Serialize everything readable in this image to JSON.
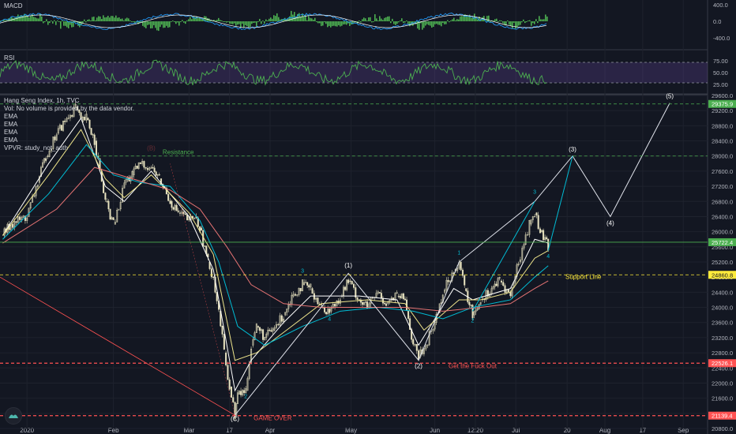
{
  "panes": {
    "macd": {
      "title": "MACD",
      "ticks": [
        "400.0",
        "0.0",
        "-400.0"
      ]
    },
    "rsi": {
      "title": "RSI",
      "ticks": [
        "75.00",
        "50.00",
        "25.00"
      ]
    }
  },
  "legend": {
    "symbol": "Hang Seng Index, 1h, TVC",
    "volume_note": "Vol: No volume is provided by the data vendor.",
    "ema_1": "EMA",
    "ema_2": "EMA",
    "ema_3": "EMA",
    "ema_4": "EMA",
    "vpvr": "VPVR: study_not_auth"
  },
  "colors": {
    "background": "#131722",
    "grid": "#1e222d",
    "candle": "#e8e3c0",
    "macd_line": "#2196f3",
    "signal_line": "#ffffff",
    "histogram": "#4caf50",
    "rsi_line": "#4caf50",
    "ema_fast": "#ffffff",
    "ema_mid": "#f0e68c",
    "ema_slow": "#00bcd4",
    "ema_long": "#e57373",
    "wave_projection": "#00bcd4",
    "support": "#ffeb3b",
    "danger": "#ff5252",
    "resistance": "#4caf50"
  },
  "chart_data": {
    "type": "candlestick",
    "title": "Hang Seng Index, 1h, TVC",
    "xlabel": "",
    "ylabel": "",
    "ylim": [
      20800,
      29600
    ],
    "y_ticks": [
      29600,
      29200,
      28800,
      28400,
      28000,
      27600,
      27200,
      26800,
      26400,
      26000,
      25600,
      25200,
      24800,
      24400,
      24000,
      23600,
      23200,
      22800,
      22400,
      22000,
      21600,
      21200,
      20800
    ],
    "x_range": [
      "2019-12-23",
      "2020-09-10"
    ],
    "x_ticks": [
      {
        "label": "2020",
        "date": "2020-01-02"
      },
      {
        "label": "Feb",
        "date": "2020-02-03"
      },
      {
        "label": "Mar",
        "date": "2020-03-02"
      },
      {
        "label": "17",
        "date": "2020-03-17"
      },
      {
        "label": "Apr",
        "date": "2020-04-01"
      },
      {
        "label": "May",
        "date": "2020-05-01"
      },
      {
        "label": "Jun",
        "date": "2020-06-01"
      },
      {
        "label": "12:20",
        "date": "2020-06-16"
      },
      {
        "label": "Jul",
        "date": "2020-07-01"
      },
      {
        "label": "20",
        "date": "2020-07-20"
      },
      {
        "label": "Aug",
        "date": "2020-08-03"
      },
      {
        "label": "17",
        "date": "2020-08-17"
      },
      {
        "label": "Sep",
        "date": "2020-09-01"
      }
    ],
    "price_path": [
      [
        "2019-12-24",
        25900
      ],
      [
        "2019-12-27",
        26200
      ],
      [
        "2020-01-02",
        26400
      ],
      [
        "2020-01-06",
        27300
      ],
      [
        "2020-01-09",
        28000
      ],
      [
        "2020-01-13",
        28600
      ],
      [
        "2020-01-16",
        28900
      ],
      [
        "2020-01-20",
        29300
      ],
      [
        "2020-01-22",
        28900
      ],
      [
        "2020-01-24",
        29000
      ],
      [
        "2020-01-27",
        28400
      ],
      [
        "2020-01-29",
        27600
      ],
      [
        "2020-01-31",
        26800
      ],
      [
        "2020-02-03",
        26200
      ],
      [
        "2020-02-05",
        26600
      ],
      [
        "2020-02-07",
        27300
      ],
      [
        "2020-02-10",
        27500
      ],
      [
        "2020-02-13",
        27800
      ],
      [
        "2020-02-17",
        27700
      ],
      [
        "2020-02-20",
        27400
      ],
      [
        "2020-02-24",
        26800
      ],
      [
        "2020-02-27",
        26500
      ],
      [
        "2020-03-02",
        26300
      ],
      [
        "2020-03-04",
        26400
      ],
      [
        "2020-03-06",
        26100
      ],
      [
        "2020-03-09",
        25200
      ],
      [
        "2020-03-11",
        24800
      ],
      [
        "2020-03-13",
        23900
      ],
      [
        "2020-03-15",
        22800
      ],
      [
        "2020-03-17",
        21900
      ],
      [
        "2020-03-19",
        21150
      ],
      [
        "2020-03-20",
        21700
      ],
      [
        "2020-03-23",
        21800
      ],
      [
        "2020-03-25",
        23000
      ],
      [
        "2020-03-27",
        23500
      ],
      [
        "2020-03-30",
        23200
      ],
      [
        "2020-04-02",
        23400
      ],
      [
        "2020-04-06",
        23800
      ],
      [
        "2020-04-09",
        24300
      ],
      [
        "2020-04-13",
        24600
      ],
      [
        "2020-04-16",
        24500
      ],
      [
        "2020-04-20",
        24000
      ],
      [
        "2020-04-23",
        23900
      ],
      [
        "2020-04-27",
        24300
      ],
      [
        "2020-04-30",
        24700
      ],
      [
        "2020-05-04",
        24200
      ],
      [
        "2020-05-07",
        24000
      ],
      [
        "2020-05-11",
        24400
      ],
      [
        "2020-05-14",
        24100
      ],
      [
        "2020-05-18",
        24300
      ],
      [
        "2020-05-21",
        24200
      ],
      [
        "2020-05-24",
        23000
      ],
      [
        "2020-05-26",
        22700
      ],
      [
        "2020-05-28",
        22900
      ],
      [
        "2020-06-01",
        23600
      ],
      [
        "2020-06-04",
        24400
      ],
      [
        "2020-06-08",
        25000
      ],
      [
        "2020-06-10",
        25200
      ],
      [
        "2020-06-12",
        24500
      ],
      [
        "2020-06-15",
        23800
      ],
      [
        "2020-06-18",
        24200
      ],
      [
        "2020-06-22",
        24500
      ],
      [
        "2020-06-25",
        24700
      ],
      [
        "2020-06-29",
        24300
      ],
      [
        "2020-07-02",
        25200
      ],
      [
        "2020-07-06",
        26200
      ],
      [
        "2020-07-08",
        26500
      ],
      [
        "2020-07-10",
        26000
      ],
      [
        "2020-07-13",
        25600
      ]
    ],
    "ema_lines": [
      {
        "color": "ema_fast",
        "points": [
          [
            "2019-12-24",
            25900
          ],
          [
            "2020-01-10",
            27800
          ],
          [
            "2020-01-22",
            29000
          ],
          [
            "2020-01-31",
            27200
          ],
          [
            "2020-02-07",
            26800
          ],
          [
            "2020-02-17",
            27600
          ],
          [
            "2020-03-02",
            26400
          ],
          [
            "2020-03-11",
            25000
          ],
          [
            "2020-03-19",
            21800
          ],
          [
            "2020-03-25",
            22600
          ],
          [
            "2020-04-06",
            23600
          ],
          [
            "2020-04-16",
            24300
          ],
          [
            "2020-05-04",
            24300
          ],
          [
            "2020-05-18",
            24200
          ],
          [
            "2020-05-26",
            23000
          ],
          [
            "2020-06-08",
            24500
          ],
          [
            "2020-06-15",
            24200
          ],
          [
            "2020-06-29",
            24500
          ],
          [
            "2020-07-08",
            25800
          ],
          [
            "2020-07-13",
            25700
          ]
        ]
      },
      {
        "color": "ema_mid",
        "points": [
          [
            "2019-12-24",
            25900
          ],
          [
            "2020-01-10",
            27500
          ],
          [
            "2020-01-22",
            28700
          ],
          [
            "2020-01-31",
            27400
          ],
          [
            "2020-02-07",
            26900
          ],
          [
            "2020-02-17",
            27500
          ],
          [
            "2020-03-02",
            26500
          ],
          [
            "2020-03-11",
            25400
          ],
          [
            "2020-03-19",
            22600
          ],
          [
            "2020-03-27",
            22800
          ],
          [
            "2020-04-09",
            23500
          ],
          [
            "2020-04-20",
            24100
          ],
          [
            "2020-05-07",
            24200
          ],
          [
            "2020-05-21",
            24100
          ],
          [
            "2020-05-28",
            23400
          ],
          [
            "2020-06-10",
            24200
          ],
          [
            "2020-06-18",
            24200
          ],
          [
            "2020-06-29",
            24400
          ],
          [
            "2020-07-08",
            25300
          ],
          [
            "2020-07-13",
            25500
          ]
        ]
      },
      {
        "color": "ema_slow",
        "points": [
          [
            "2019-12-24",
            25800
          ],
          [
            "2020-01-10",
            27000
          ],
          [
            "2020-01-24",
            28300
          ],
          [
            "2020-02-03",
            27500
          ],
          [
            "2020-02-13",
            27300
          ],
          [
            "2020-02-24",
            27200
          ],
          [
            "2020-03-06",
            26300
          ],
          [
            "2020-03-13",
            25200
          ],
          [
            "2020-03-20",
            23500
          ],
          [
            "2020-03-30",
            23000
          ],
          [
            "2020-04-13",
            23500
          ],
          [
            "2020-04-27",
            23900
          ],
          [
            "2020-05-11",
            24000
          ],
          [
            "2020-05-24",
            23900
          ],
          [
            "2020-06-04",
            23700
          ],
          [
            "2020-06-15",
            24000
          ],
          [
            "2020-06-29",
            24200
          ],
          [
            "2020-07-08",
            24800
          ],
          [
            "2020-07-13",
            25100
          ]
        ]
      },
      {
        "color": "ema_long",
        "points": [
          [
            "2019-12-24",
            25700
          ],
          [
            "2020-01-13",
            26600
          ],
          [
            "2020-01-27",
            27700
          ],
          [
            "2020-02-10",
            27400
          ],
          [
            "2020-02-24",
            27100
          ],
          [
            "2020-03-06",
            26600
          ],
          [
            "2020-03-16",
            25600
          ],
          [
            "2020-03-25",
            24600
          ],
          [
            "2020-04-06",
            24100
          ],
          [
            "2020-04-20",
            24000
          ],
          [
            "2020-05-07",
            24000
          ],
          [
            "2020-05-21",
            24000
          ],
          [
            "2020-06-04",
            23900
          ],
          [
            "2020-06-18",
            24000
          ],
          [
            "2020-06-29",
            24100
          ],
          [
            "2020-07-08",
            24500
          ],
          [
            "2020-07-13",
            24700
          ]
        ]
      }
    ],
    "wave_path": [
      [
        "2020-03-19",
        21150
      ],
      [
        "2020-04-30",
        24900
      ],
      [
        "2020-05-26",
        22600
      ],
      [
        "2020-06-10",
        25200
      ],
      [
        "2020-07-08",
        26800
      ],
      [
        "2020-07-22",
        28000
      ],
      [
        "2020-08-05",
        26400
      ],
      [
        "2020-08-27",
        29400
      ]
    ],
    "projection_path": [
      [
        "2020-06-15",
        23900
      ],
      [
        "2020-07-08",
        26800
      ]
    ],
    "projection_path_2": [
      [
        "2020-07-13",
        25500
      ],
      [
        "2020-07-22",
        28000
      ]
    ],
    "trendline": [
      [
        "2019-12-23",
        24800
      ],
      [
        "2020-03-19",
        21150
      ]
    ],
    "zigzag_red": [
      [
        "2020-03-19",
        21150
      ],
      [
        "2020-02-24",
        27800
      ]
    ],
    "horizontal_levels": [
      {
        "price": 29375.9,
        "label": "29375.9",
        "color": "resistance",
        "style": "dashed"
      },
      {
        "price": 28000,
        "label": "",
        "color": "resistance",
        "style": "dashed",
        "text": "Resistance"
      },
      {
        "price": 25722.4,
        "label": "25722.4",
        "color": "resistance",
        "style": "solid"
      },
      {
        "price": 24860.8,
        "label": "24860.8",
        "color": "support",
        "style": "dashed",
        "text": "Support Line"
      },
      {
        "price": 22526.1,
        "label": "22526.1",
        "color": "danger",
        "style": "dashed",
        "text": "Get the Fuck Out"
      },
      {
        "price": 21139.4,
        "label": "21139.4",
        "color": "danger",
        "style": "dashed",
        "text": "GAME OVER"
      }
    ],
    "wave_labels": [
      {
        "text": "(C)",
        "date": "2020-03-19",
        "price": 21000,
        "color": "#ffffff"
      },
      {
        "text": "(1)",
        "date": "2020-04-30",
        "price": 25050,
        "color": "#ffffff"
      },
      {
        "text": "(2)",
        "date": "2020-05-26",
        "price": 22400,
        "color": "#ffffff"
      },
      {
        "text": "(3)",
        "date": "2020-07-22",
        "price": 28120,
        "color": "#ffffff"
      },
      {
        "text": "(4)",
        "date": "2020-08-05",
        "price": 26170,
        "color": "#ffffff"
      },
      {
        "text": "(5)",
        "date": "2020-08-27",
        "price": 29530,
        "color": "#ffffff"
      },
      {
        "text": "3",
        "date": "2020-04-13",
        "price": 24920,
        "color": "#00bcd4"
      },
      {
        "text": "4",
        "date": "2020-04-23",
        "price": 23650,
        "color": "#00bcd4"
      },
      {
        "text": "2",
        "date": "2020-03-23",
        "price": 21600,
        "color": "#00bcd4"
      },
      {
        "text": "1",
        "date": "2020-06-10",
        "price": 25400,
        "color": "#00bcd4"
      },
      {
        "text": "2",
        "date": "2020-06-15",
        "price": 23600,
        "color": "#00bcd4"
      },
      {
        "text": "3",
        "date": "2020-07-08",
        "price": 27000,
        "color": "#00bcd4"
      },
      {
        "text": "4",
        "date": "2020-07-13",
        "price": 25300,
        "color": "#00bcd4"
      }
    ],
    "ghost_labels": [
      {
        "text": "(B)",
        "date": "2020-02-17",
        "price": 28150,
        "color": "#ff5252"
      }
    ]
  }
}
